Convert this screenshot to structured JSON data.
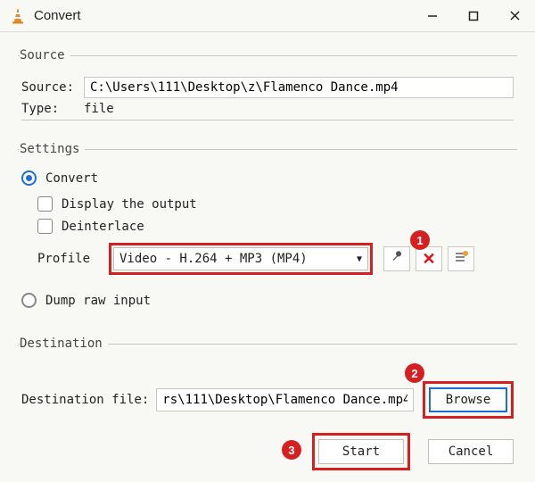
{
  "titlebar": {
    "title": "Convert"
  },
  "source": {
    "legend": "Source",
    "label": "Source:",
    "value": "C:\\Users\\111\\Desktop\\z\\Flamenco Dance.mp4",
    "type_label": "Type:",
    "type_value": "file"
  },
  "settings": {
    "legend": "Settings",
    "convert_label": "Convert",
    "display_output_label": "Display the output",
    "deinterlace_label": "Deinterlace",
    "profile_label": "Profile",
    "profile_value": "Video - H.264 + MP3 (MP4)",
    "dump_label": "Dump raw input"
  },
  "destination": {
    "legend": "Destination",
    "label": "Destination file:",
    "value": "rs\\111\\Desktop\\Flamenco Dance.mp4",
    "browse_label": "Browse"
  },
  "buttons": {
    "start": "Start",
    "cancel": "Cancel"
  },
  "callouts": {
    "c1": "1",
    "c2": "2",
    "c3": "3"
  }
}
